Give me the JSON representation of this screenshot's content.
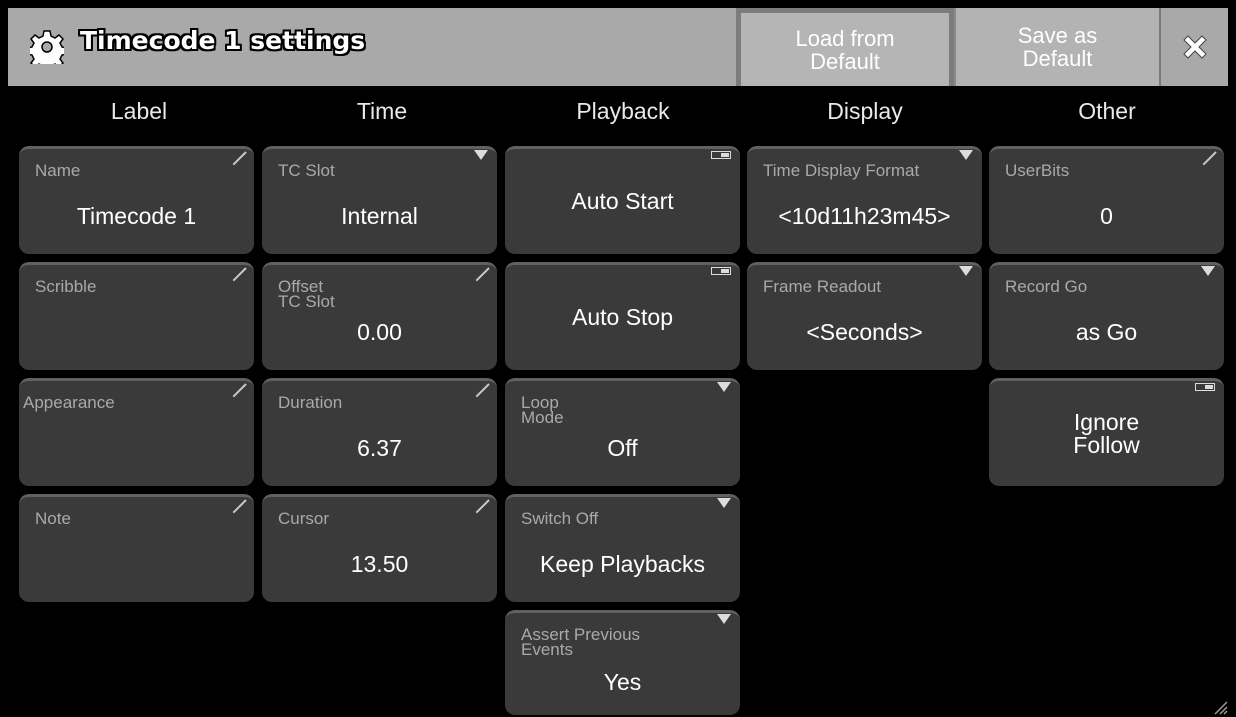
{
  "window": {
    "title": "Timecode 1 settings",
    "load_default_label": "Load from\nDefault",
    "save_default_label": "Save as\nDefault",
    "close_icon": "close-x-icon",
    "title_icon": "gear-icon"
  },
  "columns": [
    "Label",
    "Time",
    "Playback",
    "Display",
    "Other"
  ],
  "label": {
    "name": {
      "label": "Name",
      "value": "Timecode 1"
    },
    "scribble": {
      "label": "Scribble",
      "value": ""
    },
    "appearance": {
      "label": "Appearance",
      "value": ""
    },
    "note": {
      "label": "Note",
      "value": ""
    }
  },
  "time": {
    "tc_slot": {
      "label": "TC Slot",
      "value": "Internal"
    },
    "offset": {
      "label": "Offset\nTC Slot",
      "value": "0.00"
    },
    "duration": {
      "label": "Duration",
      "value": "6.37"
    },
    "cursor": {
      "label": "Cursor",
      "value": "13.50"
    }
  },
  "playback": {
    "auto_start": {
      "label": "Auto Start"
    },
    "auto_stop": {
      "label": "Auto Stop"
    },
    "loop_mode": {
      "label": "Loop\nMode",
      "value": "Off"
    },
    "switch_off": {
      "label": "Switch Off",
      "value": "Keep Playbacks"
    },
    "assert_prev": {
      "label": "Assert Previous\nEvents",
      "value": "Yes"
    }
  },
  "display": {
    "time_format": {
      "label": "Time Display Format",
      "value": "<10d11h23m45>"
    },
    "frame_readout": {
      "label": "Frame Readout",
      "value": "<Seconds>"
    }
  },
  "other": {
    "userbits": {
      "label": "UserBits",
      "value": "0"
    },
    "record_go": {
      "label": "Record Go",
      "value": "as Go"
    },
    "ignore_follow": {
      "label": "Ignore\nFollow"
    }
  },
  "colors": {
    "titlebar": "#a9a9a9",
    "tile": "#3a3a3a",
    "background": "#000000"
  }
}
